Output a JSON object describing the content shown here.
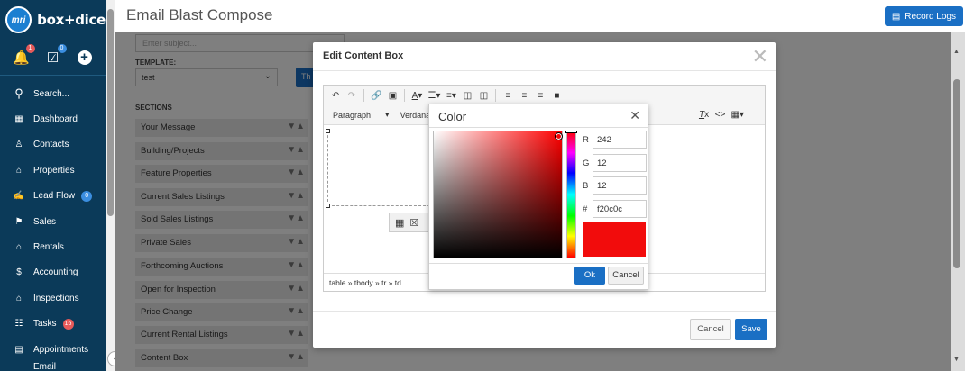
{
  "brand": {
    "logo_text": "mri",
    "name": "box+dice"
  },
  "quick_actions": {
    "notifications_badge": "1",
    "tasks_badge": "0"
  },
  "nav": {
    "search": "Search...",
    "items": [
      {
        "label": "Dashboard",
        "icon": "grid-icon",
        "glyph": "▦"
      },
      {
        "label": "Contacts",
        "icon": "person-icon",
        "glyph": "♙"
      },
      {
        "label": "Properties",
        "icon": "home-icon",
        "glyph": "⌂"
      },
      {
        "label": "Lead Flow",
        "icon": "lead-flow-icon",
        "glyph": "✍",
        "badge": "0",
        "badge_color": "blue"
      },
      {
        "label": "Sales",
        "icon": "sign-icon",
        "glyph": "⚑"
      },
      {
        "label": "Rentals",
        "icon": "rentals-icon",
        "glyph": "⌂"
      },
      {
        "label": "Accounting",
        "icon": "dollar-icon",
        "glyph": "$"
      },
      {
        "label": "Inspections",
        "icon": "inspections-icon",
        "glyph": "⌂"
      },
      {
        "label": "Tasks",
        "icon": "tasks-icon",
        "glyph": "☷",
        "badge": "16",
        "badge_color": "red"
      },
      {
        "label": "Appointments",
        "icon": "calendar-icon",
        "glyph": "▤"
      },
      {
        "label": "Email",
        "icon": "",
        "glyph": ""
      }
    ]
  },
  "header": {
    "title": "Email Blast Compose",
    "record_logs": "Record Logs"
  },
  "form": {
    "subject_placeholder": "Enter subject...",
    "template_label": "TEMPLATE:",
    "template_value": "test",
    "template_button": "Th",
    "sections_label": "SECTIONS",
    "sections": [
      "Your Message",
      "Building/Projects",
      "Feature Properties",
      "Current Sales Listings",
      "Sold Sales Listings",
      "Private Sales",
      "Forthcoming Auctions",
      "Open for Inspection",
      "Price Change",
      "Current Rental Listings",
      "Content Box"
    ]
  },
  "modal": {
    "title": "Edit Content Box",
    "paragraph_dropdown": "Paragraph",
    "font_dropdown": "Verdana",
    "statusbar_path": "table » tbody » tr » td",
    "cancel": "Cancel",
    "save": "Save"
  },
  "color_dialog": {
    "title": "Color",
    "r_label": "R",
    "r_value": "242",
    "g_label": "G",
    "g_value": "12",
    "b_label": "B",
    "b_value": "12",
    "hex_label": "#",
    "hex_value": "f20c0c",
    "preview_color": "#f20c0c",
    "ok": "Ok",
    "cancel": "Cancel"
  },
  "colors": {
    "sidebar_bg": "#0b3a59",
    "accent": "#1a6fc4"
  }
}
